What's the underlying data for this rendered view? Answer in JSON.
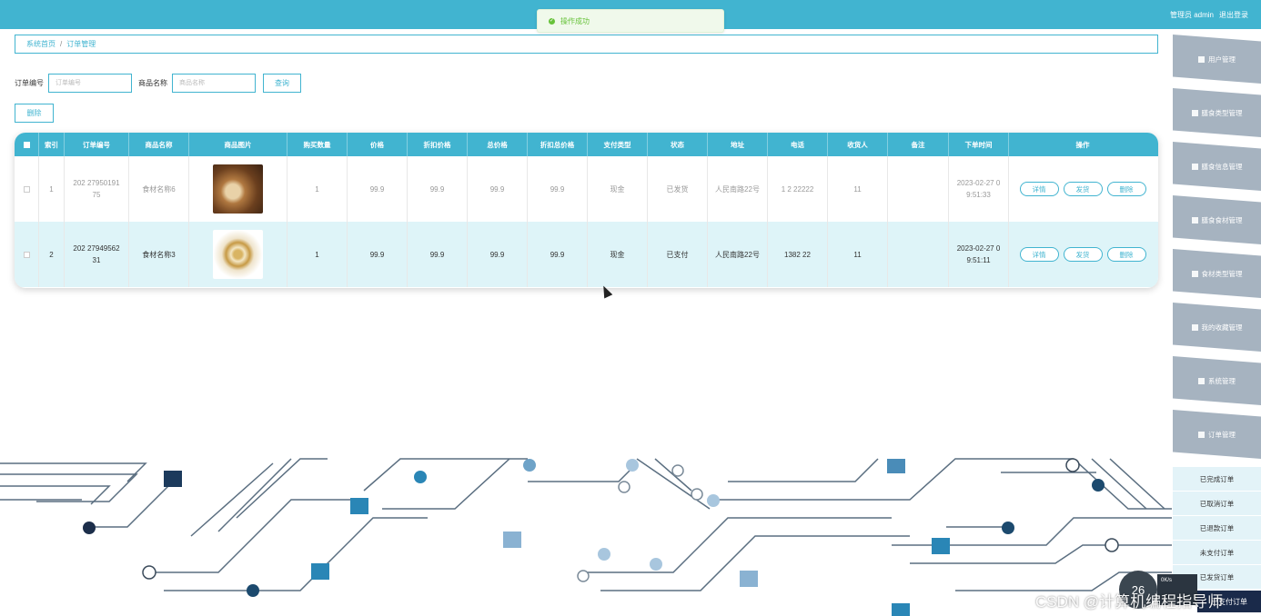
{
  "topbar": {
    "user_label": "管理员 admin",
    "logout_label": "退出登录"
  },
  "toast": {
    "message": "操作成功"
  },
  "breadcrumb": {
    "home": "系统首页",
    "separator": "/",
    "current": "订单管理"
  },
  "search": {
    "order_no_label": "订单编号",
    "order_no_placeholder": "订单编号",
    "goods_name_label": "商品名称",
    "goods_name_placeholder": "商品名称",
    "query_button": "查询"
  },
  "delete_button": "删除",
  "table": {
    "headers": [
      "索引",
      "订单编号",
      "商品名称",
      "商品图片",
      "购买数量",
      "价格",
      "折扣价格",
      "总价格",
      "折扣总价格",
      "支付类型",
      "状态",
      "地址",
      "电话",
      "收货人",
      "备注",
      "下单时间",
      "操作"
    ],
    "rows": [
      {
        "index": "1",
        "order_no": "202 27950191",
        "order_no2": "75",
        "goods_name": "食材名称6",
        "qty": "1",
        "price": "99.9",
        "discount_price": "99.9",
        "total": "99.9",
        "discount_total": "99.9",
        "pay_type": "现金",
        "status": "已发货",
        "address": "人民南路22号",
        "phone": "1 2 22222",
        "receiver": "11",
        "remark": "",
        "time1": "2023-02-27 0",
        "time2": "9:51:33"
      },
      {
        "index": "2",
        "order_no": "202 27949562",
        "order_no2": "31",
        "goods_name": "食材名称3",
        "qty": "1",
        "price": "99.9",
        "discount_price": "99.9",
        "total": "99.9",
        "discount_total": "99.9",
        "pay_type": "现金",
        "status": "已支付",
        "address": "人民南路22号",
        "phone": "1382 22",
        "receiver": "11",
        "remark": "",
        "time1": "2023-02-27 0",
        "time2": "9:51:11"
      }
    ],
    "ops": {
      "detail": "详情",
      "ship": "发货",
      "delete": "删除"
    }
  },
  "sidebar": {
    "items": [
      {
        "label": "用户管理",
        "icon": "user-icon"
      },
      {
        "label": "膳食类型管理",
        "icon": "grid-icon"
      },
      {
        "label": "膳食信息管理",
        "icon": "grid-icon"
      },
      {
        "label": "膳食食材管理",
        "icon": "grid-icon"
      },
      {
        "label": "食材类型管理",
        "icon": "grid-icon"
      },
      {
        "label": "我的收藏管理",
        "icon": "collect-icon"
      },
      {
        "label": "系统管理",
        "icon": "grid-icon"
      },
      {
        "label": "订单管理",
        "icon": "grid-icon"
      }
    ],
    "subitems": [
      "已完成订单",
      "已取消订单",
      "已退款订单",
      "未支付订单",
      "已发货订单"
    ]
  },
  "widget": {
    "fab_value": "26",
    "speed": "0K/s",
    "bottom_label": "已支付订单"
  },
  "watermark": "CSDN @计算机编程指导师",
  "colors": {
    "primary": "#41b4d0",
    "sidebar": "#a6b3c0",
    "row_alt": "#def4f8"
  }
}
